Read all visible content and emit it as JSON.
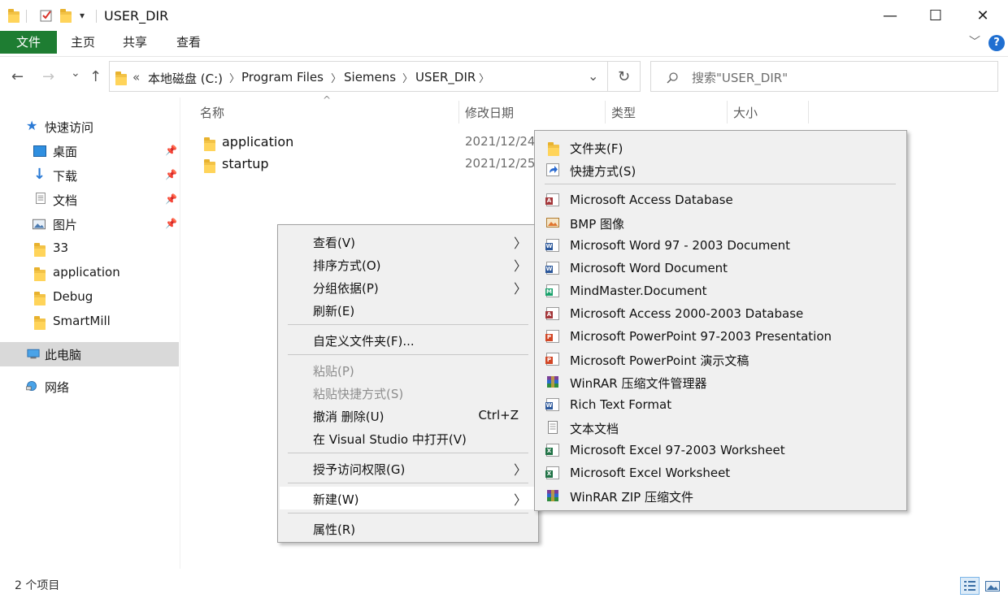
{
  "window": {
    "title": "USER_DIR",
    "minimize": "—",
    "maximize": "☐",
    "close": "✕"
  },
  "ribbon": {
    "tabs": [
      "文件",
      "主页",
      "共享",
      "查看"
    ],
    "expand": "﹀",
    "help": "?"
  },
  "address": {
    "back": "←",
    "forward": "→",
    "recent": "⌄",
    "up": "↑",
    "overflow": "«",
    "crumbs": [
      "本地磁盘 (C:)",
      "Program Files",
      "Siemens",
      "USER_DIR"
    ],
    "dropdown": "⌄",
    "refresh": "↻",
    "search_placeholder": "搜索\"USER_DIR\""
  },
  "sidebar": {
    "items": [
      {
        "label": "快速访问",
        "icon": "star-icon",
        "pinned": false
      },
      {
        "label": "桌面",
        "icon": "desktop-icon",
        "pinned": true
      },
      {
        "label": "下载",
        "icon": "download-icon",
        "pinned": true
      },
      {
        "label": "文档",
        "icon": "document-icon",
        "pinned": true
      },
      {
        "label": "图片",
        "icon": "picture-icon",
        "pinned": true
      },
      {
        "label": "33",
        "icon": "folder-icon",
        "pinned": false
      },
      {
        "label": "application",
        "icon": "folder-icon",
        "pinned": false
      },
      {
        "label": "Debug",
        "icon": "folder-icon",
        "pinned": false
      },
      {
        "label": "SmartMill",
        "icon": "folder-icon",
        "pinned": false
      },
      {
        "label": "此电脑",
        "icon": "computer-icon",
        "pinned": false
      },
      {
        "label": "网络",
        "icon": "network-icon",
        "pinned": false
      }
    ]
  },
  "columns": {
    "name": "名称",
    "date": "修改日期",
    "type": "类型",
    "size": "大小",
    "sort": "^"
  },
  "files": [
    {
      "name": "application",
      "date": "2021/12/24"
    },
    {
      "name": "startup",
      "date": "2021/12/25"
    }
  ],
  "context_menu": {
    "items": [
      {
        "label": "查看(V)",
        "submenu": true
      },
      {
        "label": "排序方式(O)",
        "submenu": true
      },
      {
        "label": "分组依据(P)",
        "submenu": true
      },
      {
        "label": "刷新(E)"
      },
      {
        "label": "自定义文件夹(F)..."
      },
      {
        "label": "粘贴(P)",
        "disabled": true
      },
      {
        "label": "粘贴快捷方式(S)",
        "disabled": true
      },
      {
        "label": "撤消 删除(U)",
        "accel": "Ctrl+Z"
      },
      {
        "label": "在 Visual Studio 中打开(V)"
      },
      {
        "label": "授予访问权限(G)",
        "submenu": true
      },
      {
        "label": "新建(W)",
        "submenu": true
      },
      {
        "label": "属性(R)"
      }
    ],
    "arrow": "〉"
  },
  "new_submenu": {
    "items": [
      {
        "label": "文件夹(F)",
        "icon": "folder-icon"
      },
      {
        "label": "快捷方式(S)",
        "icon": "shortcut-icon"
      },
      {
        "label": "Microsoft Access Database",
        "icon": "access-icon",
        "color": "#a4373a"
      },
      {
        "label": "BMP 图像",
        "icon": "bmp-icon",
        "color": "#e0752e"
      },
      {
        "label": "Microsoft Word 97 - 2003 Document",
        "icon": "word-icon",
        "color": "#2b579a"
      },
      {
        "label": "Microsoft Word Document",
        "icon": "word-icon",
        "color": "#2b579a"
      },
      {
        "label": "MindMaster.Document",
        "icon": "mindmaster-icon",
        "color": "#1aa26c"
      },
      {
        "label": "Microsoft Access 2000-2003 Database",
        "icon": "access-icon",
        "color": "#a4373a"
      },
      {
        "label": "Microsoft PowerPoint 97-2003 Presentation",
        "icon": "powerpoint-icon",
        "color": "#d24726"
      },
      {
        "label": "Microsoft PowerPoint 演示文稿",
        "icon": "powerpoint-icon",
        "color": "#d24726"
      },
      {
        "label": "WinRAR 压缩文件管理器",
        "icon": "winrar-icon",
        "color": "#7a3f98"
      },
      {
        "label": "Rich Text Format",
        "icon": "rtf-icon",
        "color": "#2b579a"
      },
      {
        "label": "文本文档",
        "icon": "text-icon",
        "color": "#777777"
      },
      {
        "label": "Microsoft Excel 97-2003 Worksheet",
        "icon": "excel-icon",
        "color": "#217346"
      },
      {
        "label": "Microsoft Excel Worksheet",
        "icon": "excel-icon",
        "color": "#217346"
      },
      {
        "label": "WinRAR ZIP 压缩文件",
        "icon": "winrar-zip-icon",
        "color": "#7a3f98"
      }
    ]
  },
  "status": {
    "count": "2 个项目"
  }
}
